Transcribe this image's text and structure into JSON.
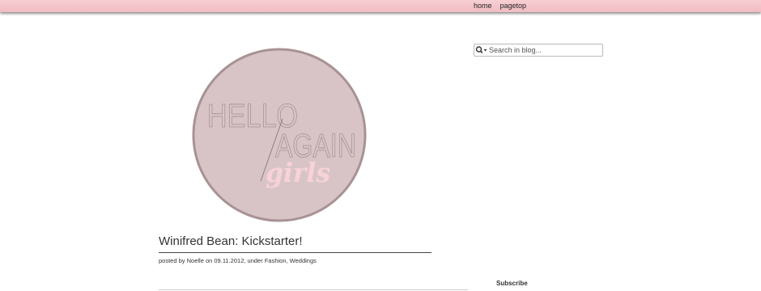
{
  "nav": {
    "home": "home",
    "pagetop": "pagetop"
  },
  "search": {
    "placeholder": "Search in blog..."
  },
  "logo": {
    "line1": "HELLO",
    "line2": "AGAIN",
    "line3": "girls",
    "circle_color": "#d8c4c6",
    "ring_color": "#a89294",
    "script_color": "#f7d3d8"
  },
  "post": {
    "title": "Winifred Bean: Kickstarter!",
    "meta_prefix": "posted by ",
    "author": "Noelle",
    "meta_on": " on ",
    "date": "09.11.2012",
    "meta_under": ", under ",
    "category_1": "Fashion",
    "meta_sep": ", ",
    "category_2": "Weddings"
  },
  "sidebar": {
    "subscribe_heading": "Subscribe"
  },
  "colors": {
    "topbar": "#f2c3c8",
    "accent": "#333333"
  }
}
